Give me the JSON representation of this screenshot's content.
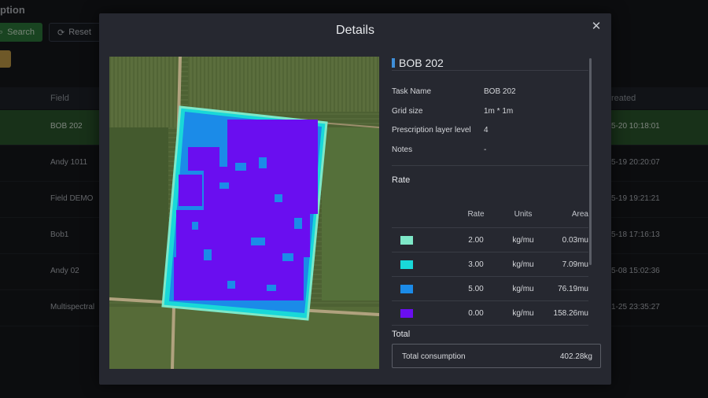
{
  "page": {
    "title": "ption",
    "search_label": "Search",
    "reset_label": "Reset",
    "table_headers": {
      "field": "Field",
      "created": "reated"
    },
    "rows": [
      {
        "field": "BOB 202",
        "created": "5-20 10:18:01",
        "active": true
      },
      {
        "field": "Andy 1011",
        "created": "5-19 20:20:07"
      },
      {
        "field": "Field DEMO",
        "created": "5-19 19:21:21"
      },
      {
        "field": "Bob1",
        "created": "5-18 17:16:13"
      },
      {
        "field": "Andy 02",
        "created": "5-08 15:02:36"
      },
      {
        "field": "Multispectral",
        "created": "1-25 23:35:27"
      }
    ]
  },
  "modal": {
    "title": "Details",
    "close_icon": "close-icon",
    "task_title": "BOB 202",
    "info": [
      {
        "key": "Task Name",
        "value": "BOB 202"
      },
      {
        "key": "Grid size",
        "value": "1m * 1m"
      },
      {
        "key": "Prescription layer level",
        "value": "4"
      },
      {
        "key": "Notes",
        "value": "-"
      }
    ],
    "rate_section": "Rate",
    "rate_headers": {
      "rate": "Rate",
      "units": "Units",
      "area": "Area"
    },
    "rates": [
      {
        "color": "#7ee8c8",
        "rate": "2.00",
        "units": "kg/mu",
        "area": "0.03mu"
      },
      {
        "color": "#19d8d8",
        "rate": "3.00",
        "units": "kg/mu",
        "area": "7.09mu"
      },
      {
        "color": "#1b8be8",
        "rate": "5.00",
        "units": "kg/mu",
        "area": "76.19mu"
      },
      {
        "color": "#6a0ef0",
        "rate": "0.00",
        "units": "kg/mu",
        "area": "158.26mu"
      }
    ],
    "total_section": "Total",
    "total_label": "Total consumption",
    "total_value": "402.28kg"
  }
}
